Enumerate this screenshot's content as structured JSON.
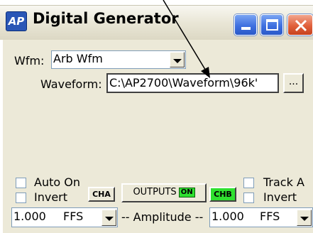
{
  "window": {
    "title": "Digital Generator",
    "icon_text": "AP"
  },
  "wfm": {
    "label": "Wfm:",
    "value": "Arb Wfm"
  },
  "waveform": {
    "label": "Waveform:",
    "value": "C:\\AP2700\\Waveform\\96k'",
    "browse_label": "..."
  },
  "channel_a": {
    "auto_on_label": "Auto On",
    "invert_label": "Invert",
    "badge": "CHA",
    "amplitude_value": "1.000",
    "amplitude_unit": "FFS"
  },
  "channel_b": {
    "track_label": "Track A",
    "invert_label": "Invert",
    "badge": "CHB",
    "amplitude_value": "1.000",
    "amplitude_unit": "FFS"
  },
  "outputs": {
    "label": "OUTPUTS",
    "state": "ON"
  },
  "amplitude_label": "-- Amplitude --",
  "colors": {
    "on_green": "#2fe02f",
    "title_blue": "#2a56b6",
    "close_red": "#e1603b"
  }
}
